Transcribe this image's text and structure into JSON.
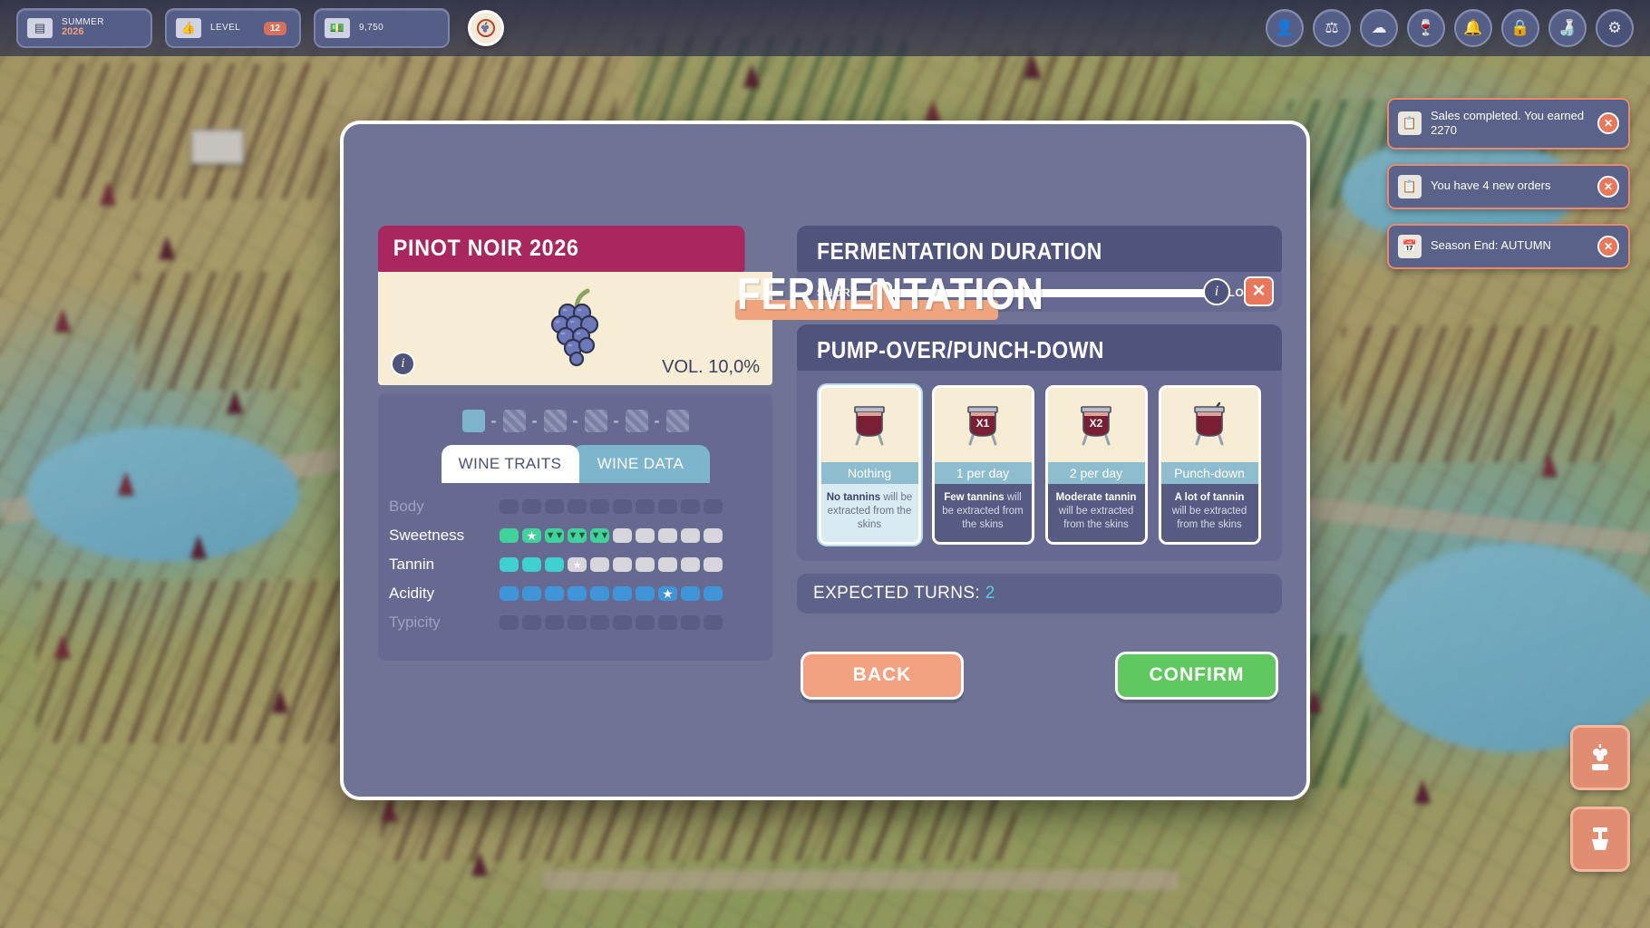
{
  "topbar": {
    "chips": [
      {
        "icon": "calendar-icon",
        "label": "SUMMER",
        "value": "2026",
        "badge": ""
      },
      {
        "icon": "thumb-up-icon",
        "label": "LEVEL",
        "value": "",
        "badge": "12"
      },
      {
        "icon": "money-icon",
        "label": "9,750",
        "value": "",
        "badge": ""
      }
    ],
    "coin_icon": "grape-coin-icon",
    "right_icons": [
      "person-icon",
      "barrel-icon",
      "cloud-icon",
      "glass-icon",
      "bell-icon",
      "lock-icon",
      "bottle-icon",
      "gear-icon"
    ]
  },
  "toasts": [
    {
      "icon": "note-icon",
      "message": "Sales completed. You earned 2270",
      "close": "✕"
    },
    {
      "icon": "note-icon",
      "message": "You have 4 new orders",
      "close": "✕"
    },
    {
      "icon": "calendar-icon",
      "message": "Season End: AUTUMN",
      "close": "✕"
    }
  ],
  "side_buttons": [
    {
      "icon": "grape-harvest-icon"
    },
    {
      "icon": "wine-press-icon"
    }
  ],
  "modal": {
    "title": "FERMENTATION",
    "info_icon": "i",
    "close_icon": "✕",
    "wine": {
      "name": "PINOT NOIR 2026",
      "art_icon": "grape-cluster-icon",
      "info_icon": "i",
      "vol_label": "VOL. 10,0%"
    },
    "stages": [
      {
        "state": "done"
      },
      {
        "state": "todo"
      },
      {
        "state": "todo"
      },
      {
        "state": "todo"
      },
      {
        "state": "todo"
      },
      {
        "state": "todo"
      }
    ],
    "stage_separator": "-",
    "tabs": [
      {
        "label": "WINE TRAITS",
        "active": true
      },
      {
        "label": "WINE DATA",
        "active": false
      }
    ],
    "traits": [
      {
        "name": "Body",
        "dim": true,
        "pips": [
          "empty",
          "empty",
          "empty",
          "empty",
          "empty",
          "empty",
          "empty",
          "empty",
          "empty",
          "empty"
        ]
      },
      {
        "name": "Sweetness",
        "dim": false,
        "color": "#3fd39a",
        "pips": [
          "fill",
          "fill-star",
          "fill-chev",
          "fill-chev",
          "fill-chev",
          "gray",
          "gray",
          "gray",
          "gray",
          "gray"
        ]
      },
      {
        "name": "Tannin",
        "dim": false,
        "color": "#3fd0d0",
        "pips": [
          "fill",
          "fill",
          "fill",
          "gray-star",
          "gray",
          "gray",
          "gray",
          "gray",
          "gray",
          "gray"
        ]
      },
      {
        "name": "Acidity",
        "dim": false,
        "color": "#3f95d8",
        "pips": [
          "fill",
          "fill",
          "fill",
          "fill",
          "fill",
          "fill",
          "fill",
          "fill-star",
          "fill",
          "fill"
        ]
      },
      {
        "name": "Typicity",
        "dim": true,
        "pips": [
          "empty",
          "empty",
          "empty",
          "empty",
          "empty",
          "empty",
          "empty",
          "empty",
          "empty",
          "empty"
        ]
      }
    ],
    "duration": {
      "heading": "FERMENTATION DURATION",
      "min_label": "SHORT",
      "max_label": "LONG",
      "value_pct": 2
    },
    "pump": {
      "heading": "PUMP-OVER/PUNCH-DOWN",
      "options": [
        {
          "icon": "vat-plain-icon",
          "vat_text": "",
          "label": "Nothing",
          "desc_bold": "No tannins",
          "desc_rest": " will be extracted from the skins",
          "selected": true
        },
        {
          "icon": "vat-x1-icon",
          "vat_text": "X1",
          "label": "1 per day",
          "desc_bold": "Few tannins",
          "desc_rest": " will be extracted from the skins",
          "selected": false
        },
        {
          "icon": "vat-x2-icon",
          "vat_text": "X2",
          "label": "2 per day",
          "desc_bold": "Moderate tannin",
          "desc_rest": " will be extracted from the skins",
          "selected": false
        },
        {
          "icon": "vat-punchdown-icon",
          "vat_text": "",
          "label": "Punch-down",
          "desc_bold": "A lot of tannin",
          "desc_rest": " will be extracted from the skins",
          "selected": false
        }
      ]
    },
    "turns": {
      "label": "EXPECTED TURNS:",
      "value": "2"
    },
    "buttons": {
      "back": "BACK",
      "confirm": "CONFIRM"
    }
  },
  "colors": {
    "accent_orange": "#f0a47d",
    "confirm_green": "#5fc85f",
    "wine_magenta": "#a7275e",
    "panel": "#6f7396",
    "teal": "#56cbe0"
  }
}
